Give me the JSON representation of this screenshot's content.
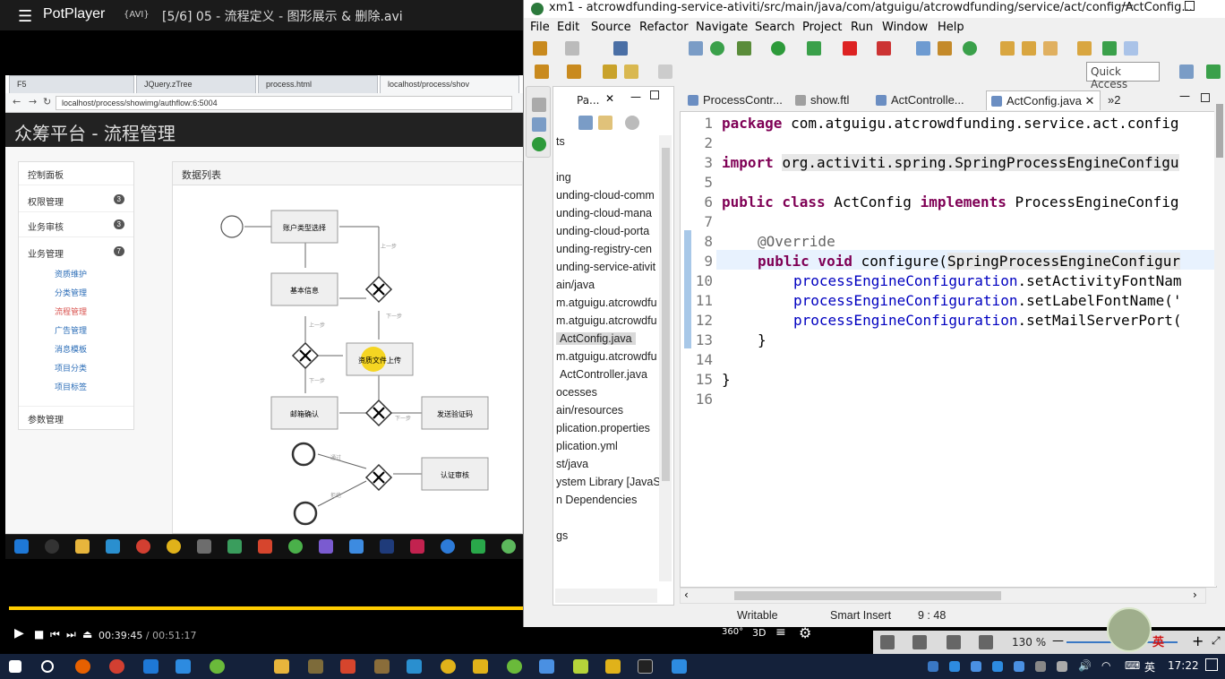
{
  "potplayer": {
    "brand": "PotPlayer",
    "format": "{AVI}",
    "file": "[5/6] 05 - 流程定义 - 图形展示 & 删除.avi",
    "time_current": "00:39:45",
    "time_sep": "/",
    "time_total": "00:51:17",
    "progress": 0.775
  },
  "browser": {
    "tabs": [
      "F5",
      "JQuery.zTree",
      "process.html",
      "localhost/process/shov"
    ],
    "url": "localhost/process/showimg/authflow:6:5004"
  },
  "webapp": {
    "title": "众筹平台 - 流程管理",
    "panel_title": "数据列表",
    "sidebar": [
      {
        "label": "控制面板"
      },
      {
        "label": "权限管理",
        "count": "3"
      },
      {
        "label": "业务审核",
        "count": "3"
      },
      {
        "label": "业务管理",
        "count": "7"
      }
    ],
    "subitems": [
      "资质维护",
      "分类管理",
      "流程管理",
      "广告管理",
      "消息模板",
      "项目分类",
      "项目标签"
    ],
    "sidebar_last": "参数管理",
    "flow_nodes": [
      "账户类型选择",
      "基本信息",
      "资质文件上传",
      "邮箱确认",
      "发送验证码",
      "认证审核"
    ],
    "flow_edges": [
      "上一步",
      "下一步",
      "上一步",
      "下一步",
      "下一步",
      "通过",
      "拒绝"
    ]
  },
  "eclipse": {
    "title": "xm1 - atcrowdfunding-service-ativiti/src/main/java/com/atguigu/atcrowdfunding/service/act/config/ActConfig...",
    "menu": [
      "File",
      "Edit",
      "Source",
      "Refactor",
      "Navigate",
      "Search",
      "Project",
      "Run",
      "Window",
      "Help"
    ],
    "quick_access": "Quick Access",
    "explorer_tab": "Pa...",
    "explorer_rows": [
      "ts",
      "",
      "ing",
      "unding-cloud-comm",
      "unding-cloud-mana",
      "unding-cloud-porta",
      "unding-registry-cen",
      "unding-service-ativit",
      "ain/java",
      "m.atguigu.atcrowdfu",
      "m.atguigu.atcrowdfu",
      "ActConfig.java",
      "m.atguigu.atcrowdfu",
      "ActController.java",
      "ocesses",
      "ain/resources",
      "plication.properties",
      "plication.yml",
      "st/java",
      "ystem Library [JavaS",
      "n Dependencies",
      "",
      "gs",
      "",
      ""
    ],
    "editor_tabs": [
      "ProcessContr...",
      "show.ftl",
      "ActControlle...",
      "ActConfig.java",
      "»2"
    ],
    "line_numbers": [
      "1",
      "2",
      "3",
      "5",
      "6",
      "7",
      "8",
      "9",
      "10",
      "11",
      "12",
      "13",
      "14",
      "15",
      "16"
    ],
    "code": {
      "l1_kw": "package",
      "l1_rest": " com.atguigu.atcrowdfunding.service.act.config",
      "l3_kw": "import",
      "l3_rest": "org.activiti.spring.SpringProcessEngineConfigu",
      "l6_kw1": "public class",
      "l6_mid": " ActConfig ",
      "l6_kw2": "implements",
      "l6_rest": " ProcessEngineConfig",
      "l8": "@Override",
      "l9_kw": "public void",
      "l9_mid": " configure(",
      "l9_hl": "SpringProcessEngineConfigur",
      "l10_fld": "processEngineConfiguration",
      "l10_rest": ".setActivityFontNam",
      "l11_fld": "processEngineConfiguration",
      "l11_rest": ".setLabelFontName('",
      "l12_fld": "processEngineConfiguration",
      "l12_rest": ".setMailServerPort(",
      "l13": "}",
      "l15": "}"
    },
    "status": {
      "writable": "Writable",
      "insert_mode": "Smart Insert",
      "position": "9 : 48"
    },
    "zoom": "130 %"
  },
  "taskbar": {
    "time": "17:22",
    "ime": "英",
    "ime_badge": "英"
  },
  "colors": {
    "keyword": "#7f0055",
    "field": "#0000c0",
    "annotation": "#646464",
    "seek": "#ffcc00",
    "taskbar": "#14213a"
  }
}
